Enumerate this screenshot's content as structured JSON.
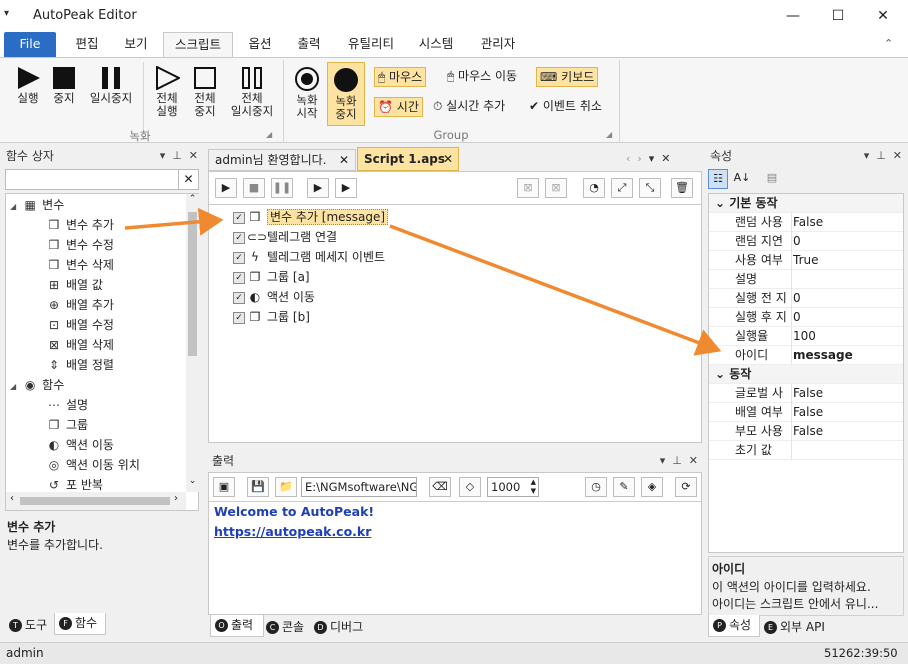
{
  "window": {
    "title": "AutoPeak Editor",
    "minimize": "—",
    "maximize": "☐",
    "close": "✕"
  },
  "ribbon_tabs": [
    "File",
    "편집",
    "보기",
    "스크립트",
    "옵션",
    "출력",
    "유틸리티",
    "시스템",
    "관리자"
  ],
  "ribbon": {
    "rec_group": {
      "label": "녹화",
      "run": "실행",
      "stop": "중지",
      "pause": "일시중지",
      "run_all_1": "전체",
      "run_all_2": "실행",
      "stop_all_1": "전체",
      "stop_all_2": "중지",
      "pause_all_1": "전체",
      "pause_all_2": "일시중지"
    },
    "group_group": {
      "label": "Group",
      "rec_start_1": "녹화",
      "rec_start_2": "시작",
      "rec_stop_1": "녹화",
      "rec_stop_2": "중지",
      "mouse_click": "마우스",
      "mouse_move": "마우스 이동",
      "keyboard": "키보드",
      "time": "시간",
      "realtime_add": "실시간 추가",
      "event_cancel": "이벤트 취소"
    }
  },
  "function_box": {
    "title": "함수 상자",
    "search_placeholder": "",
    "tree": [
      {
        "label": "변수",
        "icon": "variable-group-icon",
        "level": 0,
        "expanded": true
      },
      {
        "label": "변수 추가",
        "icon": "cube-icon",
        "level": 1
      },
      {
        "label": "변수 수정",
        "icon": "cube-icon",
        "level": 1
      },
      {
        "label": "변수 삭제",
        "icon": "cube-icon",
        "level": 1
      },
      {
        "label": "배열 값",
        "icon": "array-icon",
        "level": 1
      },
      {
        "label": "배열 추가",
        "icon": "array-add-icon",
        "level": 1
      },
      {
        "label": "배열 수정",
        "icon": "array-edit-icon",
        "level": 1
      },
      {
        "label": "배열 삭제",
        "icon": "array-delete-icon",
        "level": 1
      },
      {
        "label": "배열 정렬",
        "icon": "sort-icon",
        "level": 1
      },
      {
        "label": "함수",
        "icon": "function-group-icon",
        "level": 0,
        "expanded": true
      },
      {
        "label": "설명",
        "icon": "comment-icon",
        "level": 1
      },
      {
        "label": "그룹",
        "icon": "group-icon",
        "level": 1
      },
      {
        "label": "액션 이동",
        "icon": "goto-icon",
        "level": 1
      },
      {
        "label": "액션 이동 위치",
        "icon": "target-icon",
        "level": 1
      },
      {
        "label": "포 반복",
        "icon": "loop-icon",
        "level": 1
      }
    ],
    "desc_title": "변수 추가",
    "desc_text": "변수를 추가합니다.",
    "bottom_tabs": [
      {
        "badge": "T",
        "label": "도구"
      },
      {
        "badge": "F",
        "label": "함수"
      }
    ]
  },
  "documents": {
    "tabs": [
      "admin님 환영합니다.",
      "Script 1.aps"
    ],
    "script_rows": [
      {
        "label": "변수 추가 [message]",
        "icon": "cube-icon",
        "selected": true
      },
      {
        "label": "텔레그램 연결",
        "icon": "link-icon"
      },
      {
        "label": "텔레그램 메세지 이벤트",
        "icon": "bolt-icon"
      },
      {
        "label": "그룹 [a]",
        "icon": "group-icon"
      },
      {
        "label": "액션 이동",
        "icon": "goto-icon"
      },
      {
        "label": "그룹 [b]",
        "icon": "group-icon"
      }
    ]
  },
  "output": {
    "title": "출력",
    "path": "E:\\NGMsoftware\\NG",
    "count": "1000",
    "welcome": "Welcome to AutoPeak!",
    "link": "https://autopeak.co.kr",
    "bottom_tabs": [
      {
        "badge": "O",
        "label": "출력"
      },
      {
        "badge": "C",
        "label": "콘솔"
      },
      {
        "badge": "D",
        "label": "디버그"
      }
    ]
  },
  "properties": {
    "title": "속성",
    "sections": [
      {
        "name": "기본 동작",
        "rows": [
          {
            "key": "랜덤 사용",
            "value": "False"
          },
          {
            "key": "랜덤 지연",
            "value": "0"
          },
          {
            "key": "사용 여부",
            "value": "True"
          },
          {
            "key": "설명",
            "value": ""
          },
          {
            "key": "실행 전 지",
            "value": "0"
          },
          {
            "key": "실행 후 지",
            "value": "0"
          },
          {
            "key": "실행율",
            "value": "100"
          },
          {
            "key": "아이디",
            "value": "message",
            "bold": true
          }
        ]
      },
      {
        "name": "동작",
        "rows": [
          {
            "key": "글로벌 사",
            "value": "False"
          },
          {
            "key": "배열 여부",
            "value": "False"
          },
          {
            "key": "부모 사용",
            "value": "False"
          },
          {
            "key": "초기 값",
            "value": ""
          }
        ]
      }
    ],
    "desc_title": "아이디",
    "desc_line1": "이 액션의 아이디를 입력하세요.",
    "desc_line2": "아이디는 스크립트 안에서 유니...",
    "bottom_tabs": [
      {
        "badge": "P",
        "label": "속성"
      },
      {
        "badge": "E",
        "label": "외부 API"
      }
    ]
  },
  "status": {
    "user": "admin",
    "clock": "51262:39:50"
  },
  "colors": {
    "accent": "#2b6cc4",
    "highlight": "#fde3a2",
    "arrow": "#f08a30",
    "link": "#1d3fb8"
  }
}
